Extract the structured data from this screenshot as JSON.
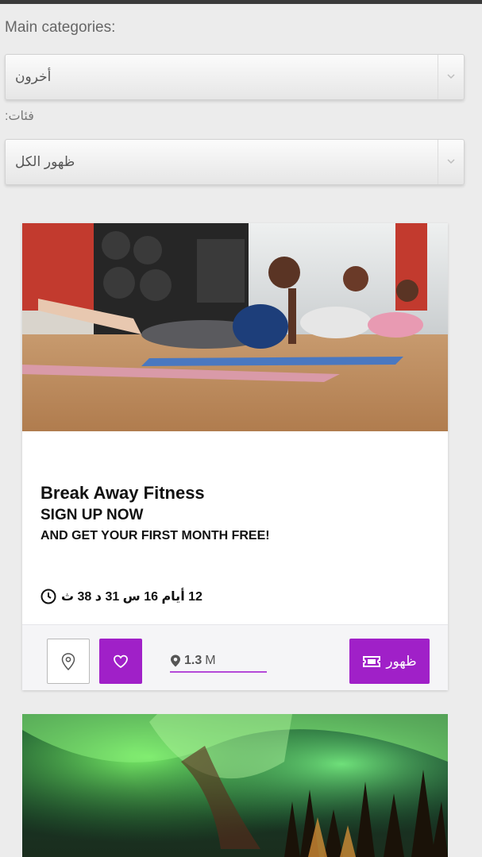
{
  "filters": {
    "main_label": "Main categories:",
    "main_value": "أخرون",
    "sub_label": ":فئات",
    "sub_value": "ظهور الكل"
  },
  "deal": {
    "title": "Break Away Fitness",
    "subtitle": "SIGN UP NOW",
    "subtitle2": "AND GET YOUR FIRST MONTH FREE!",
    "countdown": "12 أيام 16 س 31 د 38 ث",
    "distance_value": "1.3",
    "distance_unit": "M",
    "show_label": "ظهور"
  },
  "colors": {
    "accent": "#a020c8",
    "background": "#ececec"
  }
}
